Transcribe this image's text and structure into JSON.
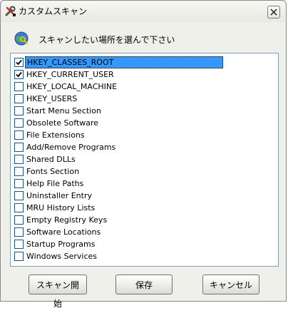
{
  "window": {
    "title": "カスタムスキャン",
    "icon": "tools-icon",
    "close_icon": "close-icon"
  },
  "hint": {
    "icon": "globe-search-icon",
    "text": "スキャンしたい場所を選んで下さい"
  },
  "items": [
    {
      "label": "HKEY_CLASSES_ROOT",
      "checked": true,
      "selected": true
    },
    {
      "label": "HKEY_CURRENT_USER",
      "checked": true,
      "selected": false
    },
    {
      "label": "HKEY_LOCAL_MACHINE",
      "checked": false,
      "selected": false
    },
    {
      "label": "HKEY_USERS",
      "checked": false,
      "selected": false
    },
    {
      "label": "Start Menu Section",
      "checked": false,
      "selected": false
    },
    {
      "label": "Obsolete Software",
      "checked": false,
      "selected": false
    },
    {
      "label": "File Extensions",
      "checked": false,
      "selected": false
    },
    {
      "label": "Add/Remove Programs",
      "checked": false,
      "selected": false
    },
    {
      "label": "Shared DLLs",
      "checked": false,
      "selected": false
    },
    {
      "label": "Fonts Section",
      "checked": false,
      "selected": false
    },
    {
      "label": "Help File Paths",
      "checked": false,
      "selected": false
    },
    {
      "label": "Uninstaller Entry",
      "checked": false,
      "selected": false
    },
    {
      "label": "MRU History Lists",
      "checked": false,
      "selected": false
    },
    {
      "label": "Empty Registry Keys",
      "checked": false,
      "selected": false
    },
    {
      "label": "Software Locations",
      "checked": false,
      "selected": false
    },
    {
      "label": "Startup Programs",
      "checked": false,
      "selected": false
    },
    {
      "label": "Windows Services",
      "checked": false,
      "selected": false
    }
  ],
  "buttons": {
    "start_scan": "スキャン開始",
    "save": "保存",
    "cancel": "キャンセル"
  },
  "colors": {
    "selection": "#3399ff",
    "checkbox_border": "#1c5180",
    "list_border": "#7f9db9"
  }
}
